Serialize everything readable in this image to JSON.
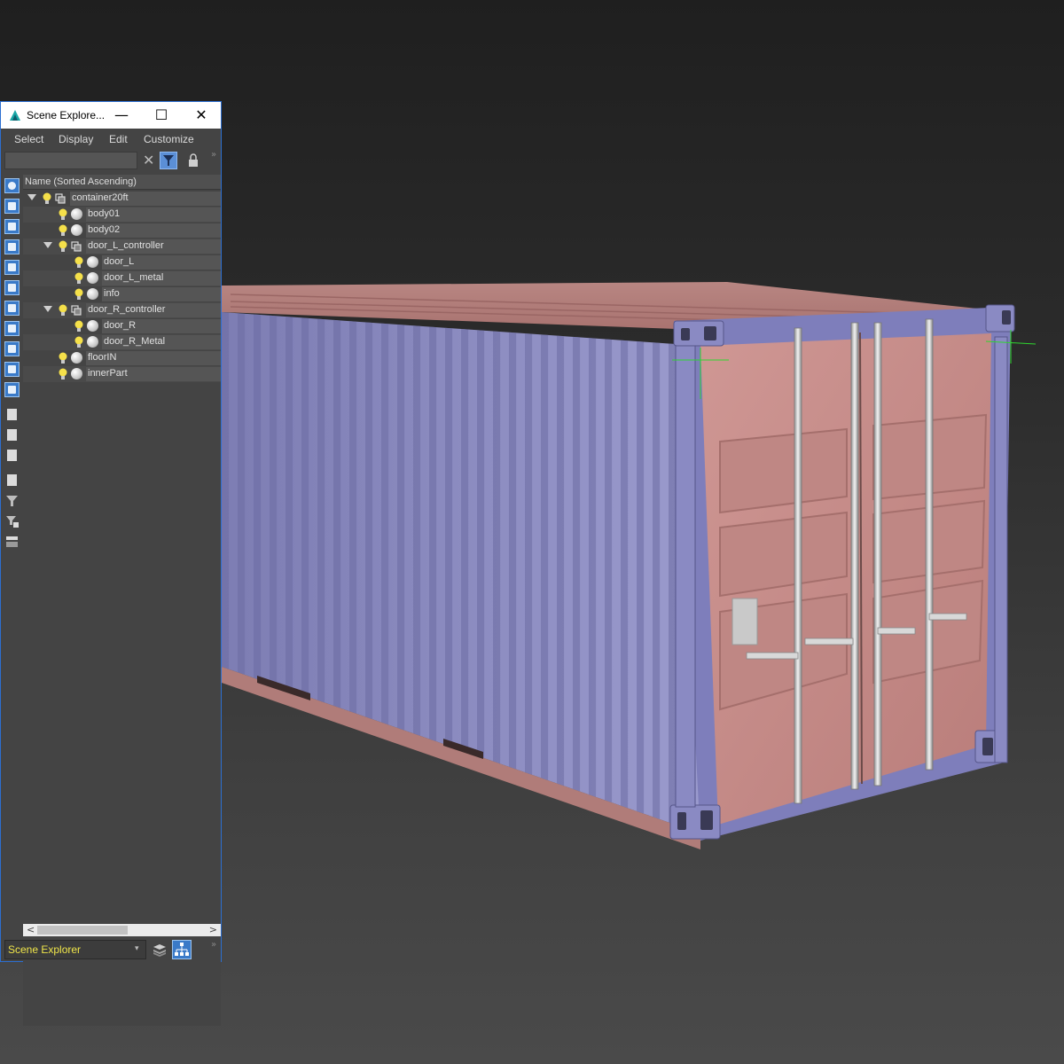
{
  "window": {
    "title": "Scene Explore...",
    "minimize_glyph": "—",
    "maximize_glyph": "☐",
    "close_glyph": "✕"
  },
  "menu": {
    "select": "Select",
    "display": "Display",
    "edit": "Edit",
    "customize": "Customize"
  },
  "search": {
    "value": "",
    "clear_glyph": "✕",
    "overflow_glyph": "»"
  },
  "column_header": "Name (Sorted Ascending)",
  "tree": [
    {
      "name": "container20ft",
      "depth": 0,
      "expanded": true,
      "kind": "group"
    },
    {
      "name": "body01",
      "depth": 1,
      "kind": "object"
    },
    {
      "name": "body02",
      "depth": 1,
      "kind": "object"
    },
    {
      "name": "door_L_controller",
      "depth": 1,
      "expanded": true,
      "kind": "group"
    },
    {
      "name": "door_L",
      "depth": 2,
      "kind": "object"
    },
    {
      "name": "door_L_metal",
      "depth": 2,
      "kind": "object"
    },
    {
      "name": "info",
      "depth": 2,
      "kind": "object"
    },
    {
      "name": "door_R_controller",
      "depth": 1,
      "expanded": true,
      "kind": "group"
    },
    {
      "name": "door_R",
      "depth": 2,
      "kind": "object"
    },
    {
      "name": "door_R_Metal",
      "depth": 2,
      "kind": "object"
    },
    {
      "name": "floorIN",
      "depth": 1,
      "kind": "object"
    },
    {
      "name": "innerPart",
      "depth": 1,
      "kind": "object"
    }
  ],
  "left_toolbar": [
    "display-geometry-icon",
    "display-shapes-icon",
    "display-lights-icon",
    "display-cameras-icon",
    "display-helpers-icon",
    "display-spacewarps-icon",
    "display-groups-icon",
    "display-xrefs-icon",
    "display-bones-icon",
    "display-containers-icon",
    "display-frozen-icon",
    "display-hidden-icon",
    "display-all-icon",
    "display-none-icon",
    "display-invert-icon",
    "filter-icon",
    "filter-options-icon",
    "sync-selection-icon"
  ],
  "hscroll": {
    "left_glyph": "<",
    "right_glyph": ">"
  },
  "statusbar": {
    "explorer_name": "Scene Explorer",
    "caret_glyph": "▾",
    "overflow_glyph": "»"
  },
  "colors": {
    "accent": "#2c6fd1",
    "container_door": "#c98d8a",
    "container_side": "#8f8fc4",
    "container_frame": "#7a7ab8",
    "explorer_name_text": "#f0e64a"
  }
}
